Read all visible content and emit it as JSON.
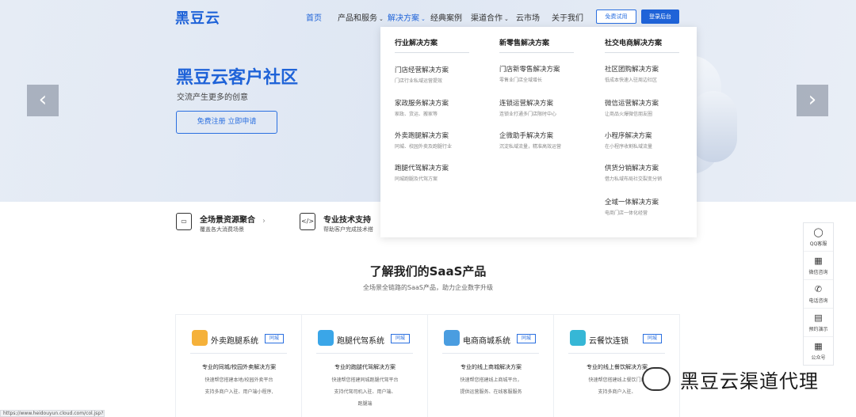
{
  "nav": {
    "logo": "黑豆云",
    "items": [
      "首页",
      "产品和服务",
      "解决方案",
      "经典案例",
      "渠道合作",
      "云市场",
      "关于我们"
    ],
    "caret": "⌄",
    "trial_button": "免费试用",
    "login_button": "登录后台"
  },
  "hero": {
    "title": "黑豆云客户社区",
    "subtitle": "交流产生更多的创意",
    "cta": "免费注册  立即申请",
    "prev": "‹",
    "next": "›"
  },
  "features": [
    {
      "icon": "stack-icon",
      "title": "全场景资源聚合",
      "desc": "覆盖各大消费场景"
    },
    {
      "icon": "code-doc-icon",
      "title": "专业技术支持",
      "desc": "帮助客户完成技术搭"
    }
  ],
  "feature_arrow": "›",
  "section": {
    "title": "了解我们的SaaS产品",
    "subtitle": "全场景全链路的SaaS产品，助力企业数字升级"
  },
  "cards": [
    {
      "name": "外卖跑腿系统",
      "tag": "同城",
      "color": "#f5b13a",
      "headline": "专业的同城/校园外卖解决方案",
      "lines": [
        "快速帮您搭建本地/校园外卖平台",
        "支持多商户入驻、用户端小程序,"
      ]
    },
    {
      "name": "跑腿代驾系统",
      "tag": "同城",
      "color": "#3aa6e8",
      "headline": "专业的跑腿代驾解决方案",
      "lines": [
        "快速帮您搭建同城跑腿代驾平台",
        "支持代驾司机入驻、用户端、",
        "跑腿端"
      ]
    },
    {
      "name": "电商商城系统",
      "tag": "同城",
      "color": "#4a9de0",
      "headline": "专业的线上商城解决方案",
      "lines": [
        "快速帮您搭建线上商城平台，",
        "提供运营服务、在线客服服务"
      ]
    },
    {
      "name": "云餐饮连锁",
      "tag": "同城",
      "color": "#36b7d6",
      "headline": "专业的线上餐饮解决方案",
      "lines": [
        "快速帮您搭建线上餐饮门店",
        "支持多商户入驻、"
      ]
    }
  ],
  "dropdown": {
    "columns": [
      {
        "head": "行业解决方案",
        "items": [
          {
            "t": "门店经营解决方案",
            "d": "门店行业私域运营提效"
          },
          {
            "t": "家政服务解决方案",
            "d": "家政、货运、搬家等"
          },
          {
            "t": "外卖跑腿解决方案",
            "d": "同城、校园外卖及跑腿行业"
          },
          {
            "t": "跑腿代驾解决方案",
            "d": "同城跑腿及代驾方案"
          }
        ]
      },
      {
        "head": "新零售解决方案",
        "items": [
          {
            "t": "门店新零售解决方案",
            "d": "零售业门店全域增长"
          },
          {
            "t": "连锁运营解决方案",
            "d": "连锁业打通多门店限时中心"
          },
          {
            "t": "企微助手解决方案",
            "d": "沉淀私域流量，精准高效运营"
          }
        ]
      },
      {
        "head": "社交电商解决方案",
        "items": [
          {
            "t": "社区团购解决方案",
            "d": "低成本快速入驻周边社区"
          },
          {
            "t": "微信运营解决方案",
            "d": "让商品火爆微信朋友圈"
          },
          {
            "t": "小程序解决方案",
            "d": "在小程序收割私域流量"
          },
          {
            "t": "供货分销解决方案",
            "d": "借力私域布局社交裂变分销"
          },
          {
            "t": "全域一体解决方案",
            "d": "电商门店一体化经营"
          }
        ]
      }
    ]
  },
  "side": [
    {
      "icon": "qq-icon",
      "glyph": "◯",
      "label": "QQ客服"
    },
    {
      "icon": "wechat-icon",
      "glyph": "▦",
      "label": "微信咨询"
    },
    {
      "icon": "phone-icon",
      "glyph": "✆",
      "label": "电话咨询"
    },
    {
      "icon": "doc-icon",
      "glyph": "▤",
      "label": "预约演示"
    },
    {
      "icon": "qrcode-icon",
      "glyph": "▦",
      "label": "公众号"
    }
  ],
  "watermark": "黑豆云渠道代理",
  "status_url": "https://www.heidouyun.cloud.com/col.jsp?id=104"
}
